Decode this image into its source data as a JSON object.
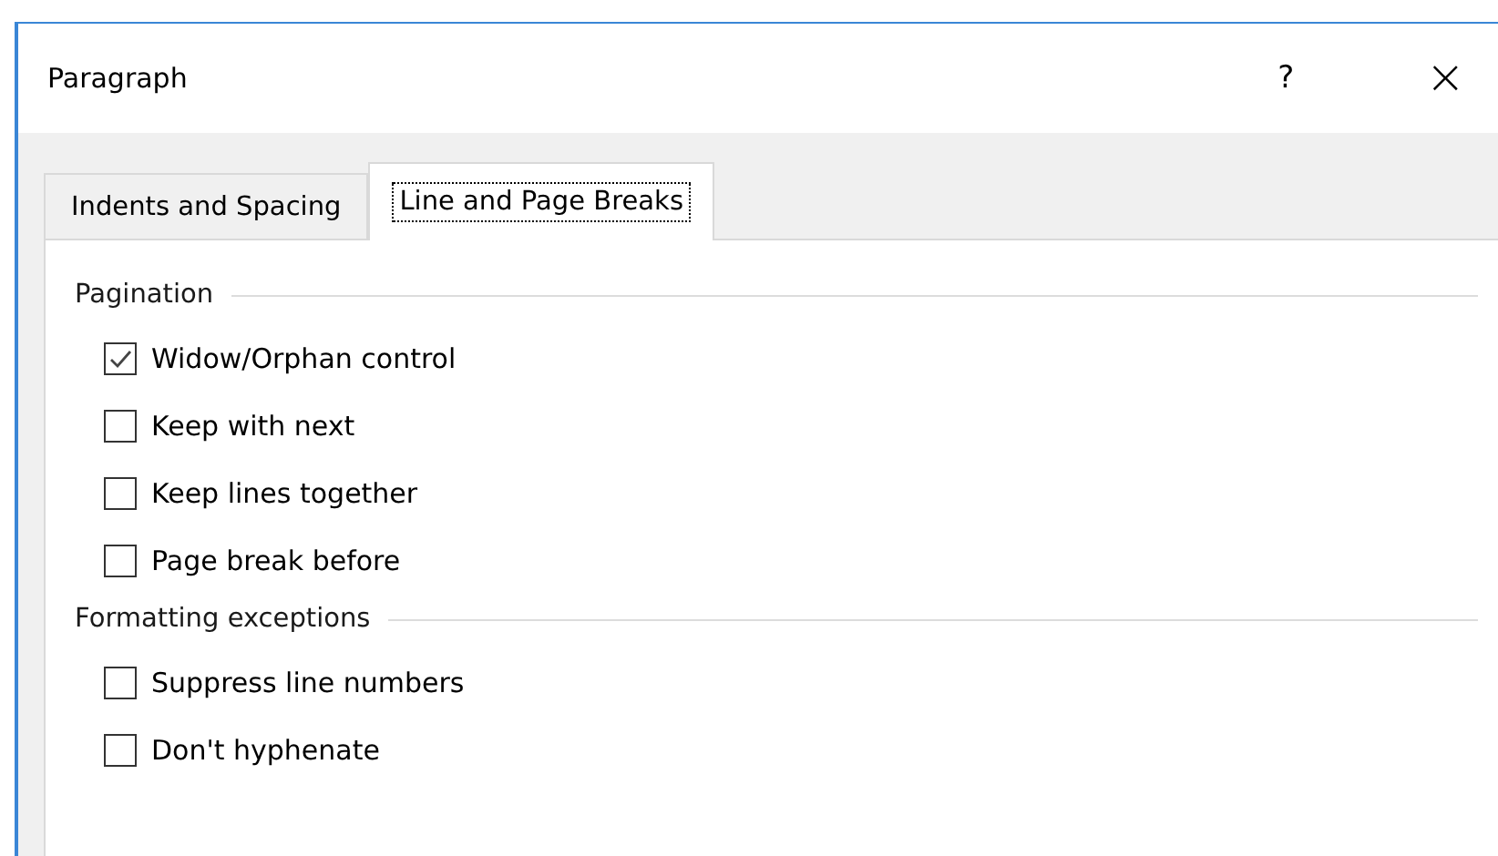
{
  "window": {
    "title": "Paragraph",
    "help": "?",
    "close": "×"
  },
  "tabs": [
    {
      "label": "Indents and Spacing",
      "selected": false
    },
    {
      "label": "Line and Page Breaks",
      "selected": true
    }
  ],
  "sections": [
    {
      "title": "Pagination",
      "options": [
        {
          "label": "Widow/Orphan control",
          "checked": true
        },
        {
          "label": "Keep with next",
          "checked": false
        },
        {
          "label": "Keep lines together",
          "checked": false
        },
        {
          "label": "Page break before",
          "checked": false
        }
      ]
    },
    {
      "title": "Formatting exceptions",
      "options": [
        {
          "label": "Suppress line numbers",
          "checked": false
        },
        {
          "label": "Don't hyphenate",
          "checked": false
        }
      ]
    }
  ]
}
